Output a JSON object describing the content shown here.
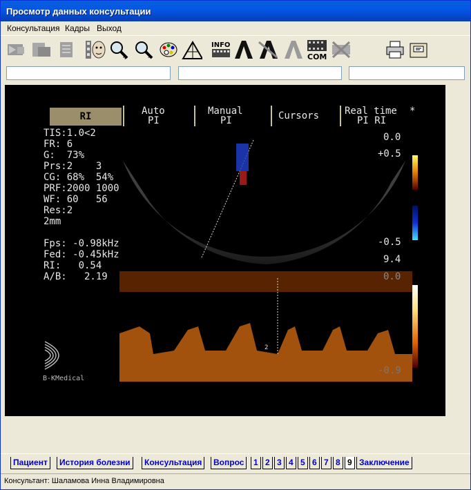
{
  "window": {
    "title": "Просмотр данных консультации"
  },
  "menu": [
    "Консультация",
    "Кадры",
    "Выход"
  ],
  "toolbar": {
    "buttons": [
      "scan-icon",
      "document-icon",
      "clipboard-icon",
      "portrait-icon",
      "zoom-in-icon",
      "zoom-out-icon",
      "palette-icon",
      "measure-icon",
      "info-icon",
      "annotate-a-icon",
      "annotate-a2-icon",
      "annotate-delete-icon",
      "film-com-icon",
      "film-delete-icon",
      "printer-icon",
      "export-icon"
    ],
    "info_label": "INFO",
    "com_label": "COM"
  },
  "fields": [
    "",
    "",
    ""
  ],
  "ultrasound": {
    "menu": {
      "ri": "RI",
      "auto_top": "Auto",
      "auto_bot": "PI",
      "manual_top": "Manual",
      "manual_bot": "PI",
      "cursors": "Cursors",
      "rt_top": "Real time",
      "rt_bot": "PI RI",
      "star": "*"
    },
    "params": [
      "TIS:1.0<2",
      "FR: 6",
      "G:  73%",
      "Prs:2    3",
      "CG: 68%  54%",
      "PRF:2000 1000",
      "WF: 60   56",
      "Res:2",
      "2mm"
    ],
    "measures": [
      "Fps: -0.98kHz",
      "Fed: -0.45kHz",
      "RI:   0.54",
      "A/B:   2.19"
    ],
    "scale": {
      "top": "0.0",
      "plus": "+0.5",
      "minus": "-0.5",
      "vel": "9.4",
      "mid": "0.0",
      "low": "-0.9"
    },
    "marker": "2",
    "brand": "B-KMedical"
  },
  "tabs": [
    "Пациент",
    "История болезни",
    "Консультация",
    "Вопрос",
    "1",
    "2",
    "3",
    "4",
    "5",
    "6",
    "7",
    "8",
    "9",
    "Заключение"
  ],
  "active_tab": "9",
  "status": "Консультант: Шаламова Инна Владимировна",
  "colors": {
    "title_bar": "#0458E6",
    "window_bg": "#ECE9D8",
    "tab_link": "#0000CC"
  }
}
